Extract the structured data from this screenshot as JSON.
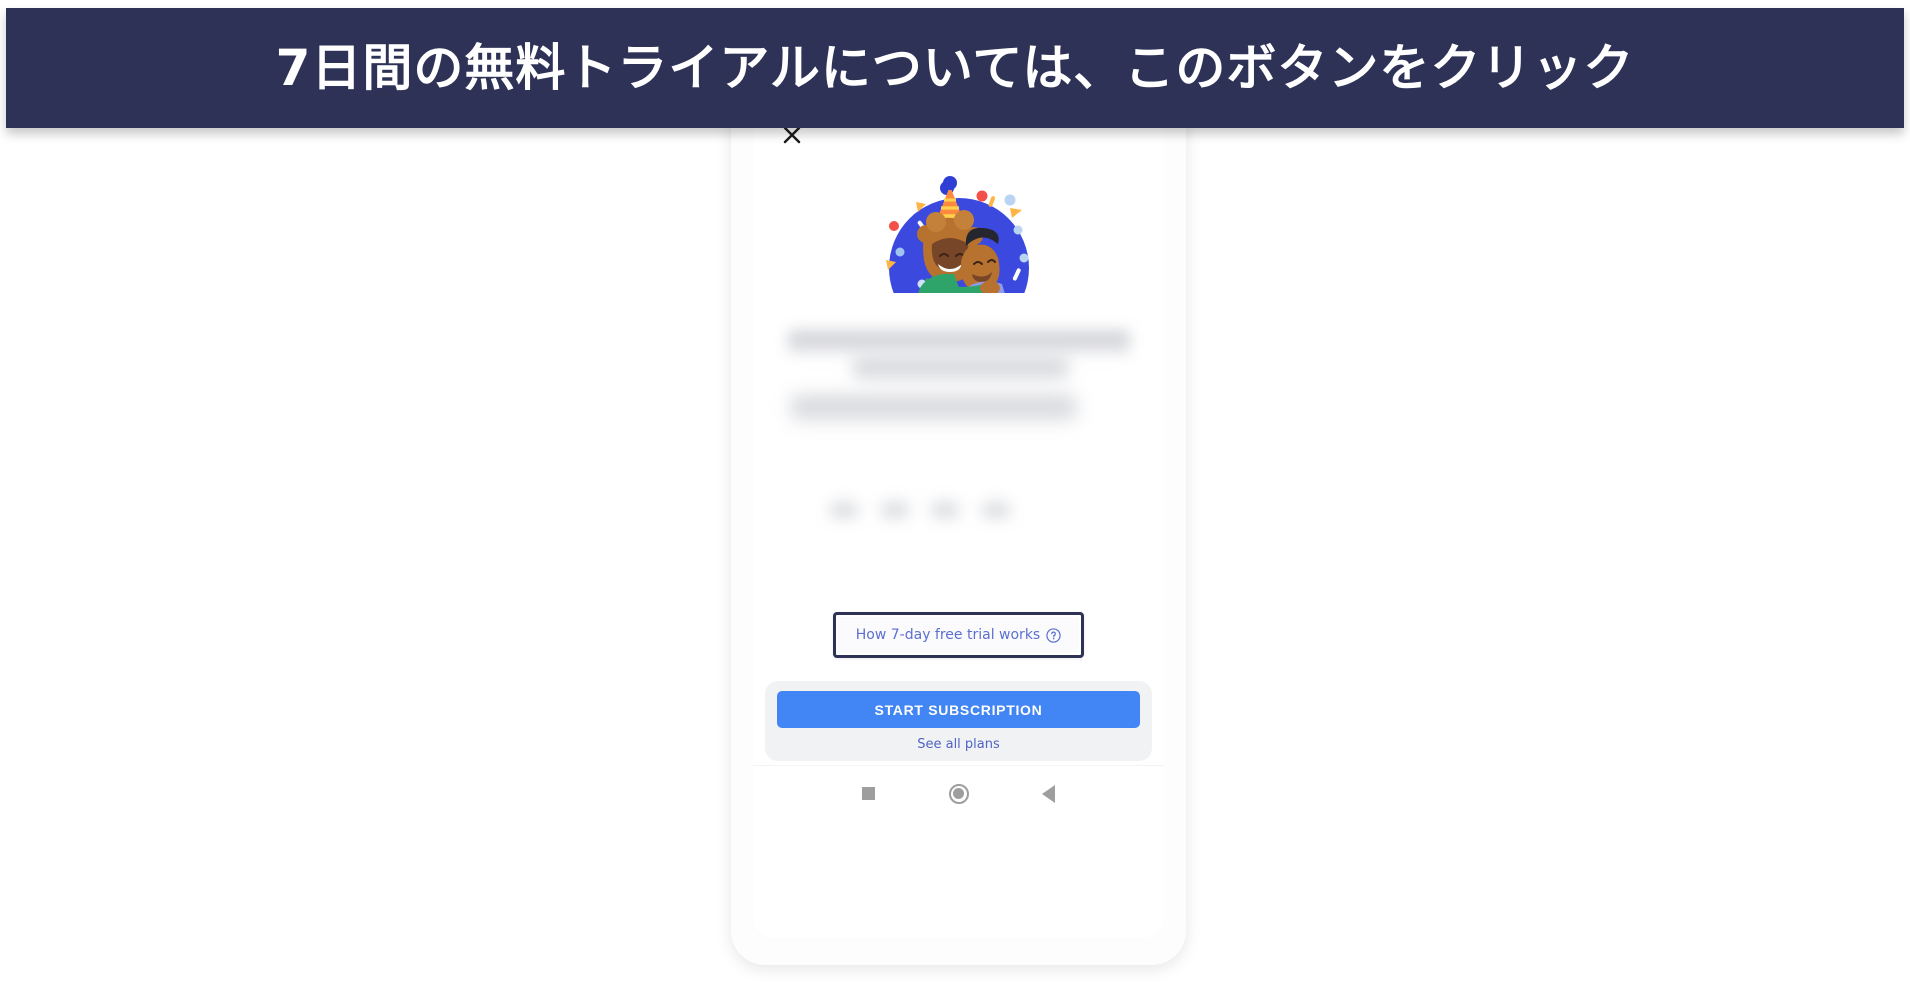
{
  "banner": {
    "text": "7日間の無料トライアルについては、このボタンをクリック",
    "background_color": "#2e3256",
    "text_color": "#ffffff"
  },
  "phone": {
    "close_icon_label": "×",
    "hero": {
      "icon_name": "celebrating-couple-illustration",
      "circle_color": "#3b49df",
      "confetti_colors": [
        "#ff7043",
        "#f44336",
        "#ffc107",
        "#90caf9",
        "#3b49df",
        "#ffffff"
      ],
      "hat_color": "#ff8a3d",
      "woman_shirt_color": "#2ea36a",
      "man_shirt_color": "#8f9bea"
    },
    "redacted_blocks": {
      "note": "blurred / redacted text lines",
      "count": 3,
      "chip_count": 4
    },
    "trial_button": {
      "label": "How 7-day free trial works",
      "icon_name": "question-mark-circle-icon",
      "text_color": "#5b6fd0",
      "highlight_border_color": "#2e3256"
    },
    "cta": {
      "primary_label": "START SUBSCRIPTION",
      "primary_color": "#4285f4",
      "secondary_label": "See all plans",
      "secondary_color": "#4f63c4",
      "card_background": "#f1f2f4"
    },
    "nav_bar": {
      "items": [
        {
          "label": "Recents",
          "icon_name": "square-recents-icon"
        },
        {
          "label": "Home",
          "icon_name": "circle-home-icon"
        },
        {
          "label": "Back",
          "icon_name": "triangle-back-icon"
        }
      ],
      "icon_color": "#9e9e9e"
    }
  }
}
